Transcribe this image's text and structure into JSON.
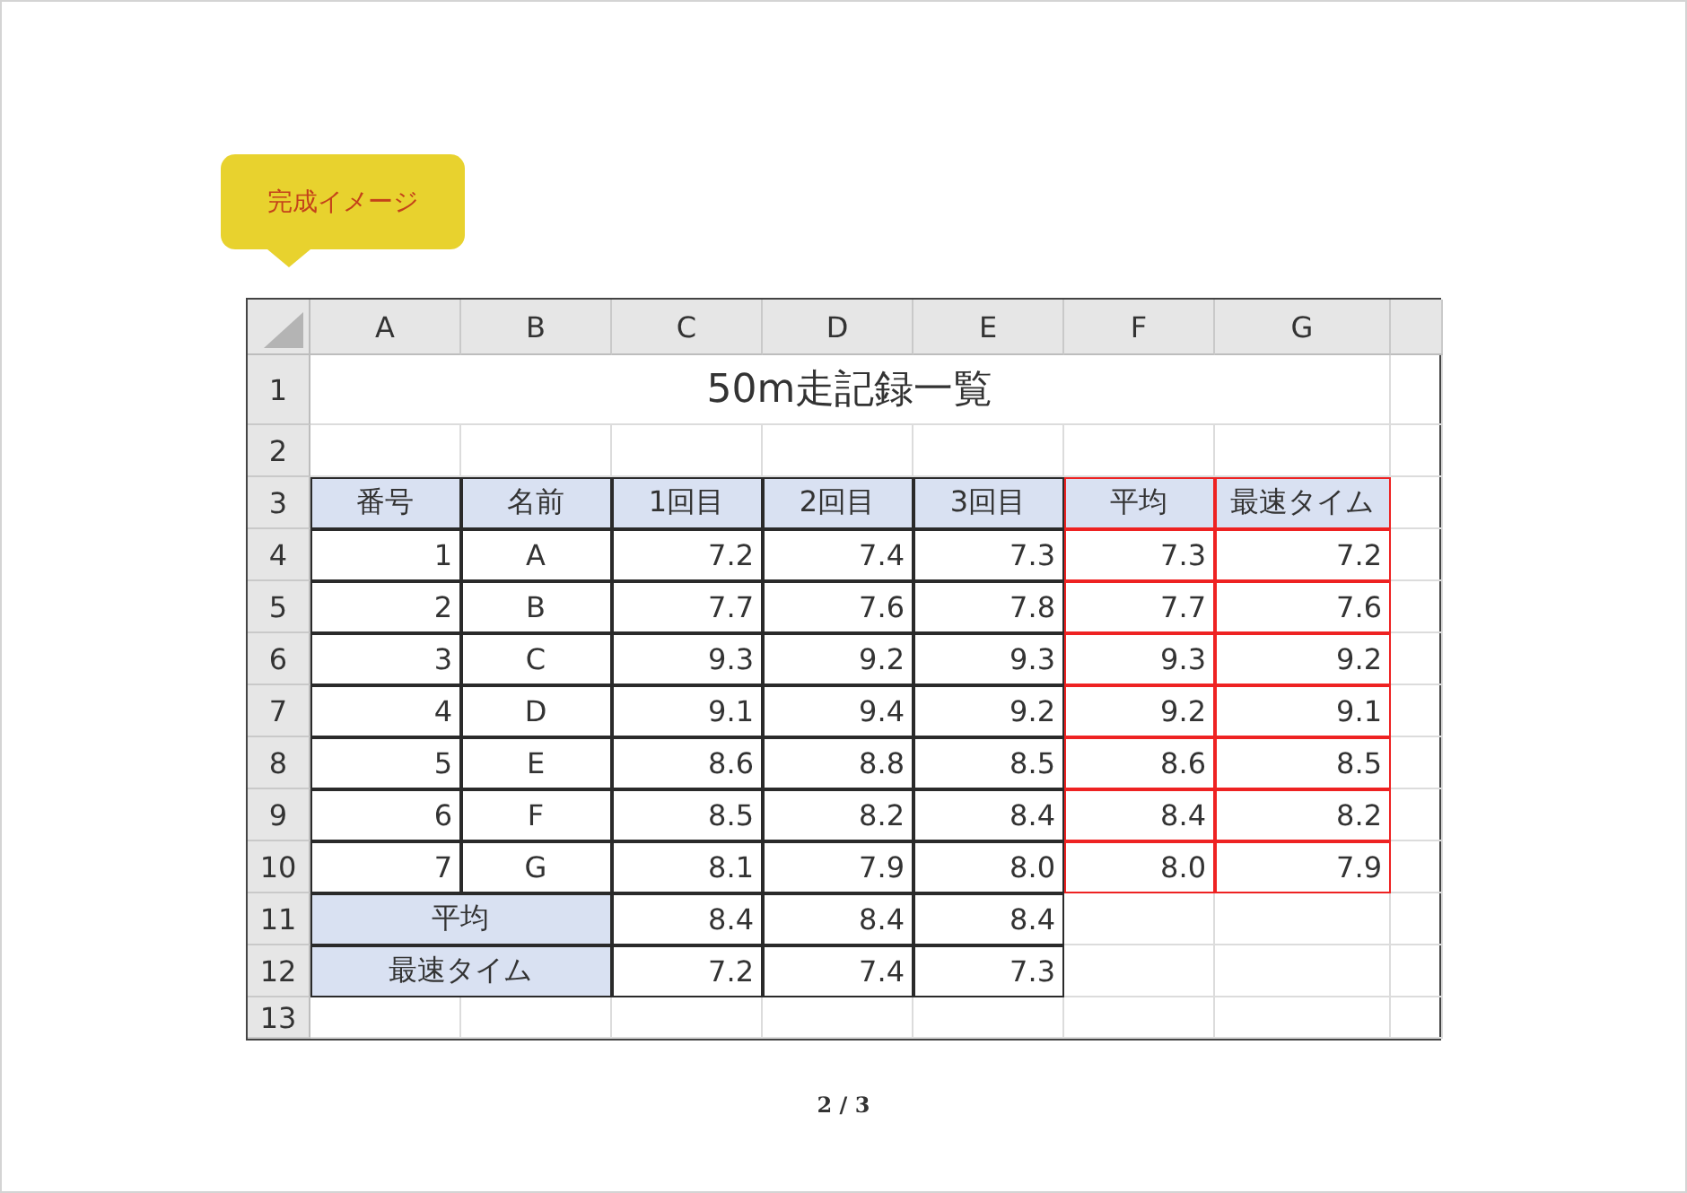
{
  "callout": {
    "text": "完成イメージ"
  },
  "sheet": {
    "columns": [
      "A",
      "B",
      "C",
      "D",
      "E",
      "F",
      "G"
    ],
    "row_numbers": [
      "1",
      "2",
      "3",
      "4",
      "5",
      "6",
      "7",
      "8",
      "9",
      "10",
      "11",
      "12",
      "13"
    ],
    "title": "50m走記録一覧",
    "header": [
      {
        "text": "番号",
        "highlighted": false
      },
      {
        "text": "名前",
        "highlighted": false
      },
      {
        "text": "1回目",
        "highlighted": false
      },
      {
        "text": "2回目",
        "highlighted": false
      },
      {
        "text": "3回目",
        "highlighted": false
      },
      {
        "text": "平均",
        "highlighted": true
      },
      {
        "text": "最速タイム",
        "highlighted": true
      }
    ],
    "records": [
      {
        "cells": [
          "1",
          "A",
          "7.2",
          "7.4",
          "7.3",
          "7.3",
          "7.2"
        ]
      },
      {
        "cells": [
          "2",
          "B",
          "7.7",
          "7.6",
          "7.8",
          "7.7",
          "7.6"
        ]
      },
      {
        "cells": [
          "3",
          "C",
          "9.3",
          "9.2",
          "9.3",
          "9.3",
          "9.2"
        ]
      },
      {
        "cells": [
          "4",
          "D",
          "9.1",
          "9.4",
          "9.2",
          "9.2",
          "9.1"
        ]
      },
      {
        "cells": [
          "5",
          "E",
          "8.6",
          "8.8",
          "8.5",
          "8.6",
          "8.5"
        ]
      },
      {
        "cells": [
          "6",
          "F",
          "8.5",
          "8.2",
          "8.4",
          "8.4",
          "8.2"
        ]
      },
      {
        "cells": [
          "7",
          "G",
          "8.1",
          "7.9",
          "8.0",
          "8.0",
          "7.9"
        ]
      }
    ],
    "summary": [
      {
        "label": "平均",
        "cells": [
          "8.4",
          "8.4",
          "8.4"
        ]
      },
      {
        "label": "最速タイム",
        "cells": [
          "7.2",
          "7.4",
          "7.3"
        ]
      }
    ]
  },
  "page_indicator": "2 / 3"
}
